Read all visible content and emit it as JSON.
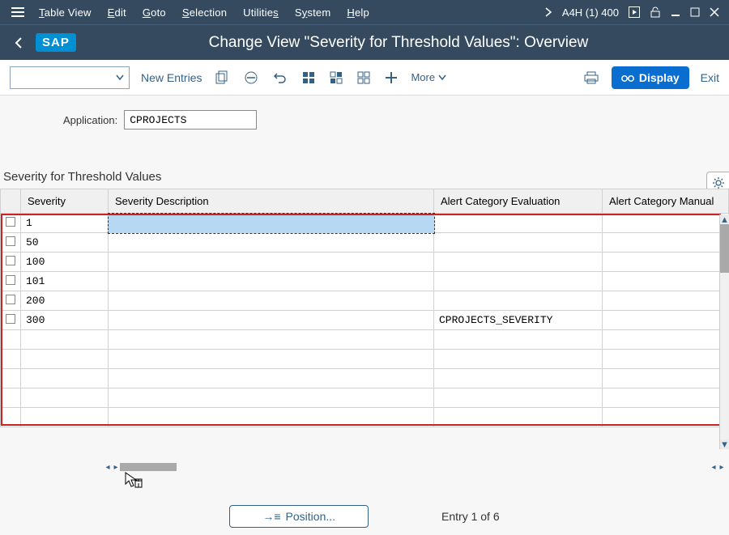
{
  "menu": {
    "items": [
      "Table View",
      "Edit",
      "Goto",
      "Selection",
      "Utilities",
      "System",
      "Help"
    ],
    "system_id": "A4H (1) 400"
  },
  "title": "Change View \"Severity for Threshold Values\": Overview",
  "logo_text": "SAP",
  "toolbar": {
    "new_entries": "New Entries",
    "more": "More",
    "display": "Display",
    "exit": "Exit"
  },
  "form": {
    "application_label": "Application:",
    "application_value": "CPROJECTS"
  },
  "section_title": "Severity for Threshold Values",
  "columns": {
    "severity": "Severity",
    "description": "Severity Description",
    "evaluation": "Alert Category Evaluation",
    "manual": "Alert Category Manual"
  },
  "rows": [
    {
      "severity": "1",
      "description": "",
      "evaluation": "",
      "manual": ""
    },
    {
      "severity": "50",
      "description": "",
      "evaluation": "",
      "manual": ""
    },
    {
      "severity": "100",
      "description": "",
      "evaluation": "",
      "manual": ""
    },
    {
      "severity": "101",
      "description": "",
      "evaluation": "",
      "manual": ""
    },
    {
      "severity": "200",
      "description": "",
      "evaluation": "",
      "manual": ""
    },
    {
      "severity": "300",
      "description": "",
      "evaluation": "CPROJECTS_SEVERITY",
      "manual": ""
    }
  ],
  "footer": {
    "position_label": "Position...",
    "entry_info": "Entry 1 of 6"
  }
}
